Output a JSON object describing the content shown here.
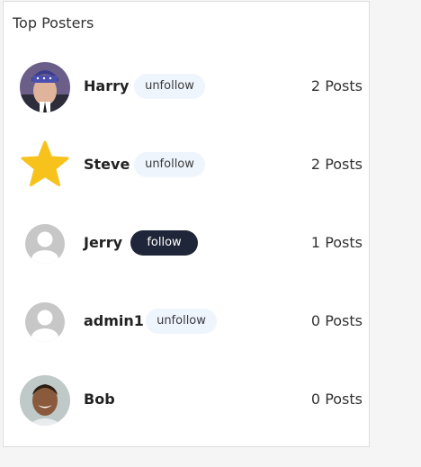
{
  "panel": {
    "title": "Top Posters"
  },
  "posters": [
    {
      "name": "Harry",
      "button": "unfollow",
      "posts": "2 Posts",
      "avatar": "photo-avatar-bandana"
    },
    {
      "name": "Steve",
      "button": "unfollow",
      "posts": "2 Posts",
      "avatar": "star-icon"
    },
    {
      "name": "Jerry",
      "button": "follow",
      "posts": "1 Posts",
      "avatar": "default-user-icon"
    },
    {
      "name": "admin1",
      "button": "unfollow",
      "posts": "0 Posts",
      "avatar": "default-user-icon"
    },
    {
      "name": "Bob",
      "button": "",
      "posts": "0 Posts",
      "avatar": "photo-avatar-smiling"
    }
  ],
  "colors": {
    "follow_button_bg": "#202639",
    "unfollow_button_bg": "#eef5fc",
    "star": "#f7c21b"
  }
}
